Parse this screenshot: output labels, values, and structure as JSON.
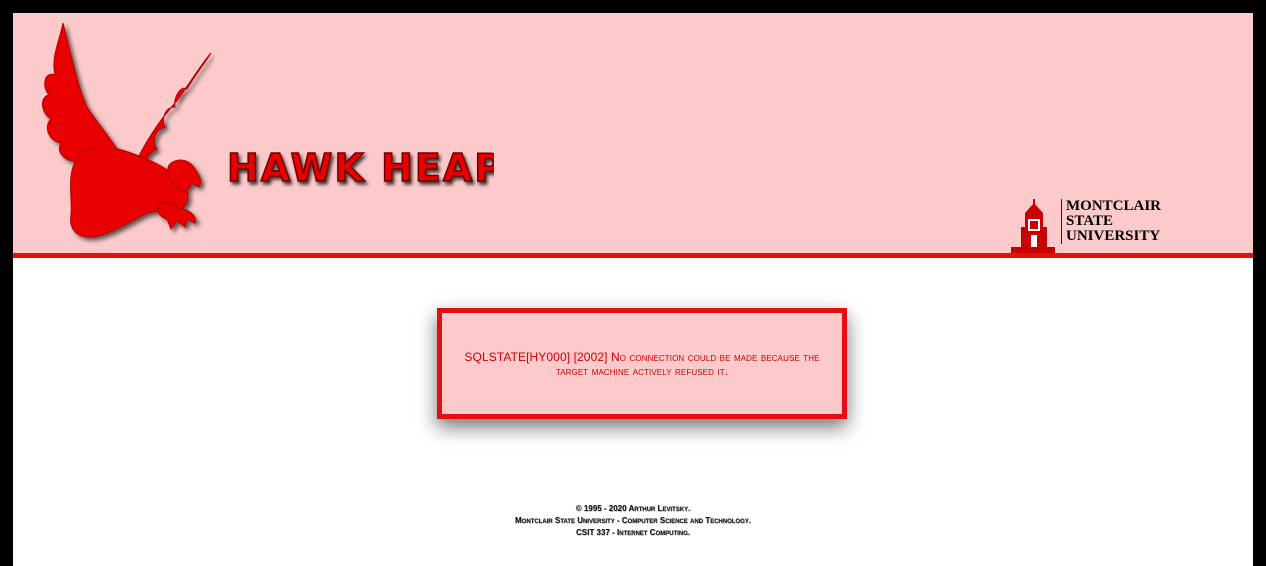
{
  "header": {
    "site_title": "HAWK HEAP",
    "university_logo_text": "MONTCLAIR\nSTATE\nUNIVERSITY",
    "colors": {
      "header_bg": "#fccaca",
      "accent_red": "#e21010"
    },
    "icons": [
      "hawk-logo-icon",
      "university-tower-icon"
    ]
  },
  "main": {
    "error_message": "SQLSTATE[HY000] [2002] No connection could be made because the target machine actively refused it."
  },
  "footer": {
    "line1": "© 1995 - 2020 Arthur Levitsky.",
    "line2": "Montclair State University - Computer Science and Technology.",
    "line3": "CSIT 337 - Internet Computing."
  }
}
